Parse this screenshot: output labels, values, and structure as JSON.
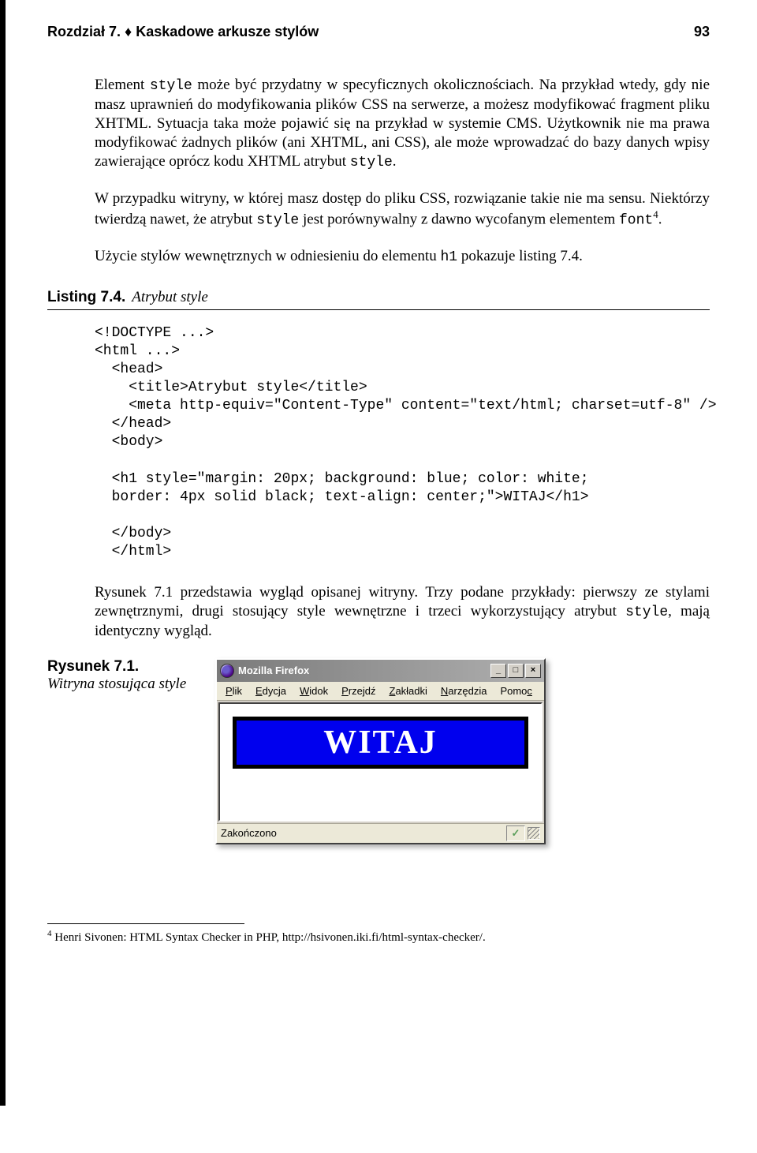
{
  "header": {
    "chapter": "Rozdział 7. ♦ Kaskadowe arkusze stylów",
    "page": "93"
  },
  "paragraphs": {
    "p1a": "Element ",
    "p1b": " może być przydatny w specyficznych okolicznościach. Na przykład wtedy, gdy nie masz uprawnień do modyfikowania plików CSS na serwerze, a możesz modyfikować fragment pliku XHTML. Sytuacja taka może pojawić się na przykład w systemie CMS. Użytkownik nie ma prawa modyfikować żadnych plików (ani XHTML, ani CSS), ale może wprowadzać do bazy danych wpisy zawierające oprócz kodu XHTML atrybut ",
    "p1c": ".",
    "p2a": "W przypadku witryny, w której masz dostęp do pliku CSS, rozwiązanie takie nie ma sensu. Niektórzy twierdzą nawet, że atrybut ",
    "p2b": " jest porównywalny z dawno wycofanym elementem ",
    "p2sup": "4",
    "p2c": ".",
    "p3a": "Użycie stylów wewnętrznych w odniesieniu do elementu ",
    "p3b": " pokazuje listing 7.4.",
    "p4a": "Rysunek 7.1 przedstawia wygląd opisanej witryny. Trzy podane przykłady: pierwszy ze stylami zewnętrznymi, drugi stosujący style wewnętrzne i trzeci wykorzystujący atrybut ",
    "p4b": ", mają identyczny wygląd."
  },
  "mono": {
    "style": "style",
    "font": "font",
    "h1": "h1"
  },
  "listing": {
    "label": "Listing 7.4.",
    "caption": "Atrybut style",
    "code": "<!DOCTYPE ...>\n<html ...>\n  <head>\n    <title>Atrybut style</title>\n    <meta http-equiv=\"Content-Type\" content=\"text/html; charset=utf-8\" />\n  </head>\n  <body>\n\n  <h1 style=\"margin: 20px; background: blue; color: white;\n  border: 4px solid black; text-align: center;\">WITAJ</h1>\n\n  </body>\n  </html>"
  },
  "figure": {
    "label": "Rysunek 7.1.",
    "desc": "Witryna stosująca style"
  },
  "browser": {
    "title": "Mozilla Firefox",
    "menu": {
      "plik": "Plik",
      "plik_u": "P",
      "edycja": "Edycja",
      "edycja_u": "E",
      "widok": "Widok",
      "widok_u": "W",
      "przejdz": "Przejdź",
      "przejdz_u": "P",
      "zakladki": "Zakładki",
      "zakladki_u": "Z",
      "narzedzia": "Narzędzia",
      "narzedzia_u": "N",
      "pomoc": "Pomoc",
      "pomoc_u": "c"
    },
    "witaj": "WITAJ",
    "status": "Zakończono",
    "btn_min": "_",
    "btn_max": "□",
    "btn_close": "×",
    "check": "✓"
  },
  "footnote": {
    "num": "4",
    "text": " Henri Sivonen: HTML Syntax Checker in PHP, http://hsivonen.iki.fi/html-syntax-checker/."
  }
}
